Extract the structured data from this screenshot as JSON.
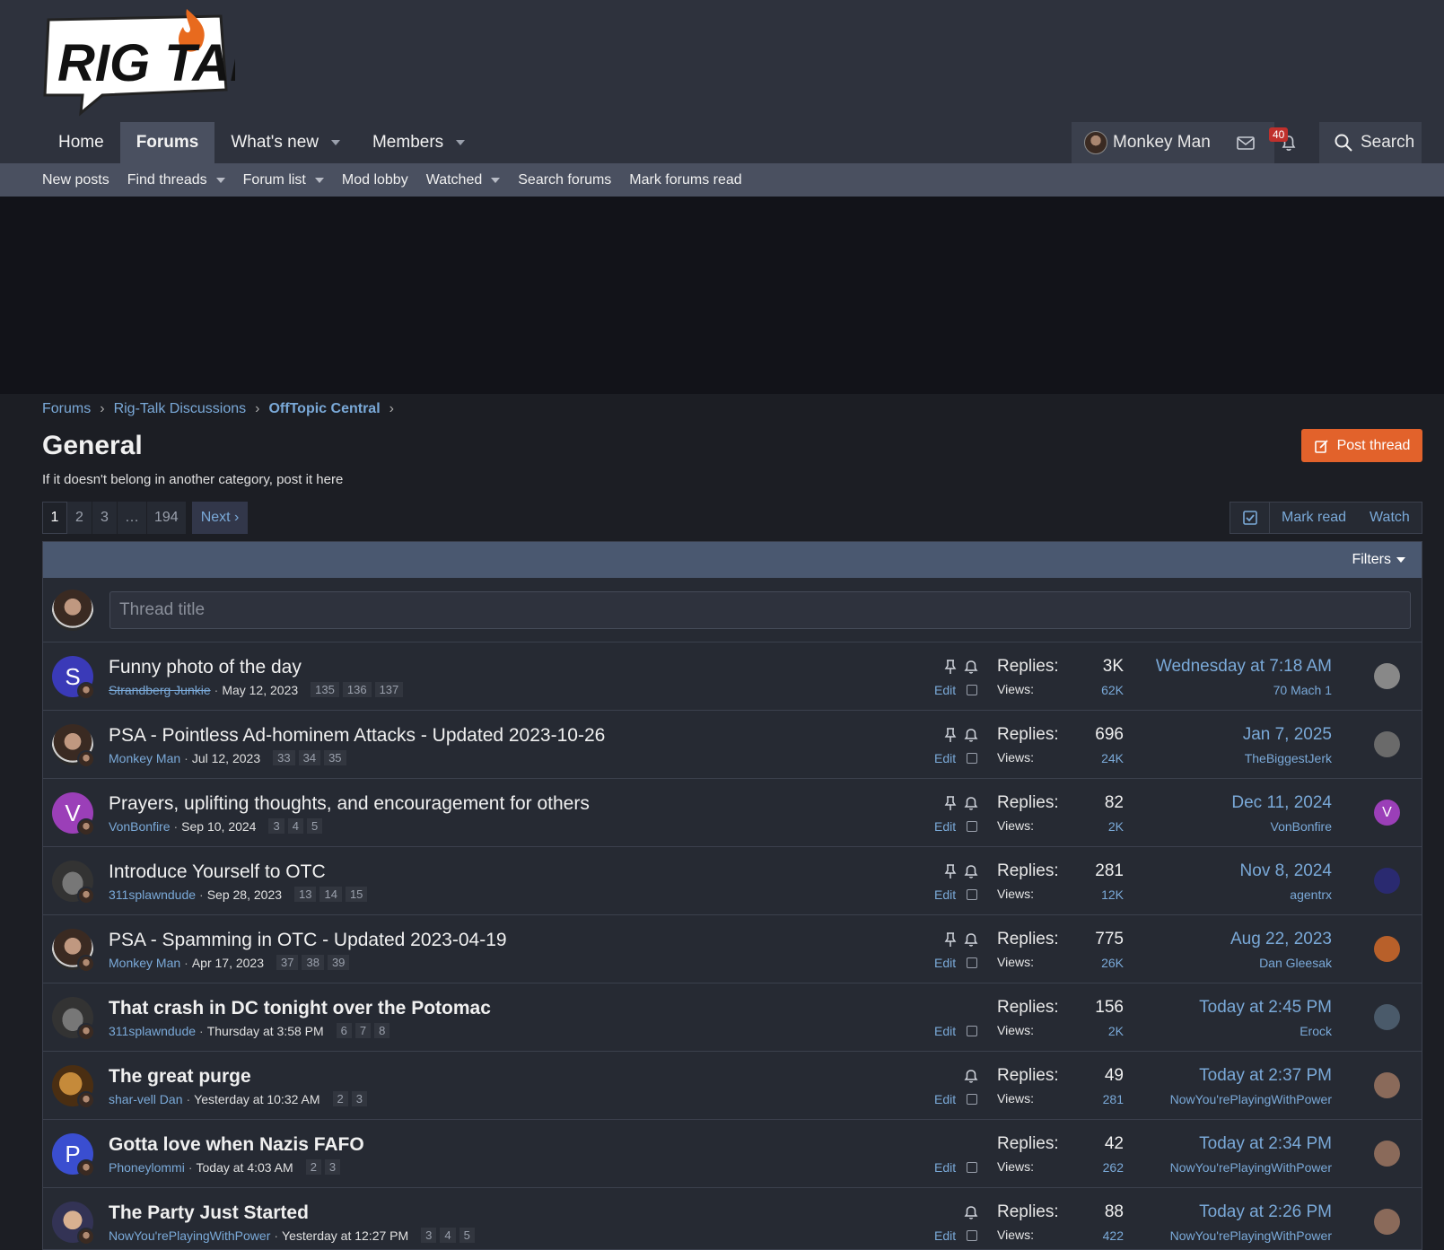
{
  "header": {
    "logo_text": "RIG TALK",
    "nav": [
      {
        "label": "Home",
        "active": false,
        "dropdown": false
      },
      {
        "label": "Forums",
        "active": true,
        "dropdown": false
      },
      {
        "label": "What's new",
        "active": false,
        "dropdown": true
      },
      {
        "label": "Members",
        "active": false,
        "dropdown": true
      }
    ],
    "user_name": "Monkey Man",
    "alerts_count": "40",
    "search_label": "Search"
  },
  "subnav": [
    {
      "label": "New posts",
      "dropdown": false
    },
    {
      "label": "Find threads",
      "dropdown": true
    },
    {
      "label": "Forum list",
      "dropdown": true
    },
    {
      "label": "Mod lobby",
      "dropdown": false
    },
    {
      "label": "Watched",
      "dropdown": true
    },
    {
      "label": "Search forums",
      "dropdown": false
    },
    {
      "label": "Mark forums read",
      "dropdown": false
    }
  ],
  "breadcrumb": [
    "Forums",
    "Rig-Talk Discussions",
    "OffTopic Central"
  ],
  "page": {
    "title": "General",
    "description": "If it doesn't belong in another category, post it here",
    "post_thread_label": "Post thread"
  },
  "pagination": {
    "pages": [
      "1",
      "2",
      "3",
      "…",
      "194"
    ],
    "current": "1",
    "next_label": "Next ›"
  },
  "actions": {
    "mark_read": "Mark read",
    "watch": "Watch"
  },
  "list": {
    "filters_label": "Filters",
    "thread_title_placeholder": "Thread title",
    "replies_label": "Replies:",
    "views_label": "Views:",
    "edit_label": "Edit"
  },
  "threads": [
    {
      "title": "Funny photo of the day",
      "bold": false,
      "author": "Strandberg Junkie",
      "author_strike": true,
      "date": "May 12, 2023",
      "pages": [
        "135",
        "136",
        "137"
      ],
      "sticky": true,
      "watched": true,
      "replies": "3K",
      "views": "62K",
      "last_date": "Wednesday at 7:18 AM",
      "last_user": "70 Mach 1",
      "avatar_letter": "S",
      "avatar_color": "#3a3ab8",
      "avatar_style": "letter",
      "last_avatar_letter": "",
      "last_avatar_color": "#888888"
    },
    {
      "title": "PSA - Pointless Ad-hominem Attacks - Updated 2023-10-26",
      "bold": false,
      "author": "Monkey Man",
      "author_strike": false,
      "date": "Jul 12, 2023",
      "pages": [
        "33",
        "34",
        "35"
      ],
      "sticky": true,
      "watched": true,
      "replies": "696",
      "views": "24K",
      "last_date": "Jan 7, 2025",
      "last_user": "TheBiggestJerk",
      "avatar_letter": "",
      "avatar_color": "",
      "avatar_style": "monkey",
      "last_avatar_letter": "",
      "last_avatar_color": "#6a6a6a"
    },
    {
      "title": "Prayers, uplifting thoughts, and encouragement for others",
      "bold": false,
      "author": "VonBonfire",
      "author_strike": false,
      "date": "Sep 10, 2024",
      "pages": [
        "3",
        "4",
        "5"
      ],
      "sticky": true,
      "watched": true,
      "replies": "82",
      "views": "2K",
      "last_date": "Dec 11, 2024",
      "last_user": "VonBonfire",
      "avatar_letter": "V",
      "avatar_color": "#9b3fb8",
      "avatar_style": "letter",
      "last_avatar_letter": "V",
      "last_avatar_color": "#9b3fb8"
    },
    {
      "title": "Introduce Yourself to OTC",
      "bold": false,
      "author": "311splawndude",
      "author_strike": false,
      "date": "Sep 28, 2023",
      "pages": [
        "13",
        "14",
        "15"
      ],
      "sticky": true,
      "watched": true,
      "replies": "281",
      "views": "12K",
      "last_date": "Nov 8, 2024",
      "last_user": "agentrx",
      "avatar_letter": "",
      "avatar_color": "",
      "avatar_style": "car",
      "last_avatar_letter": "",
      "last_avatar_color": "#2a2a70"
    },
    {
      "title": "PSA - Spamming in OTC - Updated 2023-04-19",
      "bold": false,
      "author": "Monkey Man",
      "author_strike": false,
      "date": "Apr 17, 2023",
      "pages": [
        "37",
        "38",
        "39"
      ],
      "sticky": true,
      "watched": true,
      "replies": "775",
      "views": "26K",
      "last_date": "Aug 22, 2023",
      "last_user": "Dan Gleesak",
      "avatar_letter": "",
      "avatar_color": "",
      "avatar_style": "monkey",
      "last_avatar_letter": "",
      "last_avatar_color": "#b8602a"
    },
    {
      "title": "That crash in DC tonight over the Potomac",
      "bold": true,
      "author": "311splawndude",
      "author_strike": false,
      "date": "Thursday at 3:58 PM",
      "pages": [
        "6",
        "7",
        "8"
      ],
      "sticky": false,
      "watched": false,
      "replies": "156",
      "views": "2K",
      "last_date": "Today at 2:45 PM",
      "last_user": "Erock",
      "avatar_letter": "",
      "avatar_color": "",
      "avatar_style": "car",
      "last_avatar_letter": "",
      "last_avatar_color": "#4a5a6a"
    },
    {
      "title": "The great purge",
      "bold": true,
      "author": "shar-vell Dan",
      "author_strike": false,
      "date": "Yesterday at 10:32 AM",
      "pages": [
        "2",
        "3"
      ],
      "sticky": false,
      "watched": true,
      "replies": "49",
      "views": "281",
      "last_date": "Today at 2:37 PM",
      "last_user": "NowYou'rePlayingWithPower",
      "avatar_letter": "",
      "avatar_color": "",
      "avatar_style": "tiger",
      "last_avatar_letter": "",
      "last_avatar_color": "#8a6a5a"
    },
    {
      "title": "Gotta love when Nazis FAFO",
      "bold": true,
      "author": "Phoneylommi",
      "author_strike": false,
      "date": "Today at 4:03 AM",
      "pages": [
        "2",
        "3"
      ],
      "sticky": false,
      "watched": false,
      "replies": "42",
      "views": "262",
      "last_date": "Today at 2:34 PM",
      "last_user": "NowYou'rePlayingWithPower",
      "avatar_letter": "P",
      "avatar_color": "#3a4ed0",
      "avatar_style": "letter",
      "last_avatar_letter": "",
      "last_avatar_color": "#8a6a5a"
    },
    {
      "title": "The Party Just Started",
      "bold": true,
      "author": "NowYou'rePlayingWithPower",
      "author_strike": false,
      "date": "Yesterday at 12:27 PM",
      "pages": [
        "3",
        "4",
        "5"
      ],
      "sticky": false,
      "watched": true,
      "replies": "88",
      "views": "422",
      "last_date": "Today at 2:26 PM",
      "last_user": "NowYou'rePlayingWithPower",
      "avatar_letter": "",
      "avatar_color": "",
      "avatar_style": "party",
      "last_avatar_letter": "",
      "last_avatar_color": "#8a6a5a"
    }
  ]
}
